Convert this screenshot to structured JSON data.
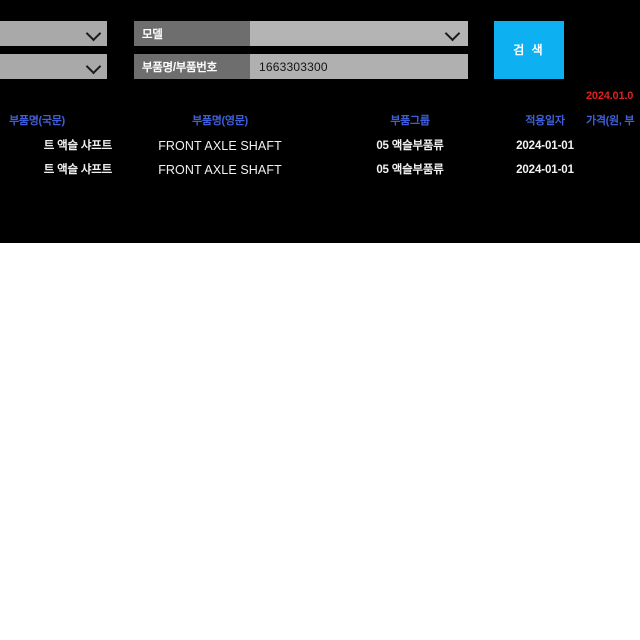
{
  "form": {
    "left_selects": [
      {
        "name": "filter-select-1",
        "value": "",
        "icon": "chevron-down-icon"
      },
      {
        "name": "filter-select-2",
        "value": "",
        "icon": "chevron-down-icon"
      }
    ],
    "model_field": {
      "label": "모델",
      "value": "",
      "icon": "chevron-down-icon"
    },
    "part_field": {
      "label": "부품명/부품번호",
      "value": "1663303300",
      "placeholder": ""
    },
    "search_button": "검 색"
  },
  "table": {
    "headers": {
      "part_name_kor": "부품명(국문)",
      "part_name_eng": "부품명(영문)",
      "part_group": "부품그룹",
      "apply_date": "적용일자",
      "price": "가격(원, 부"
    },
    "price_note": "2024.01.0",
    "rows": [
      {
        "part_name_kor": "트 액슬 샤프트",
        "part_name_eng": "FRONT AXLE SHAFT",
        "part_group": "05 액슬부품류",
        "apply_date": "2024-01-01",
        "price": ""
      },
      {
        "part_name_kor": "트 액슬 샤프트",
        "part_name_eng": "FRONT AXLE SHAFT",
        "part_group": "05 액슬부품류",
        "apply_date": "2024-01-01",
        "price": ""
      }
    ]
  },
  "colors": {
    "panel_background": "#000000",
    "page_background": "#ffffff",
    "accent_button": "#0db0f0",
    "header_text": "#3f5fd8",
    "note_text": "#e02020",
    "control_face": "#b0b0b0",
    "label_face": "#6e6e6e"
  }
}
